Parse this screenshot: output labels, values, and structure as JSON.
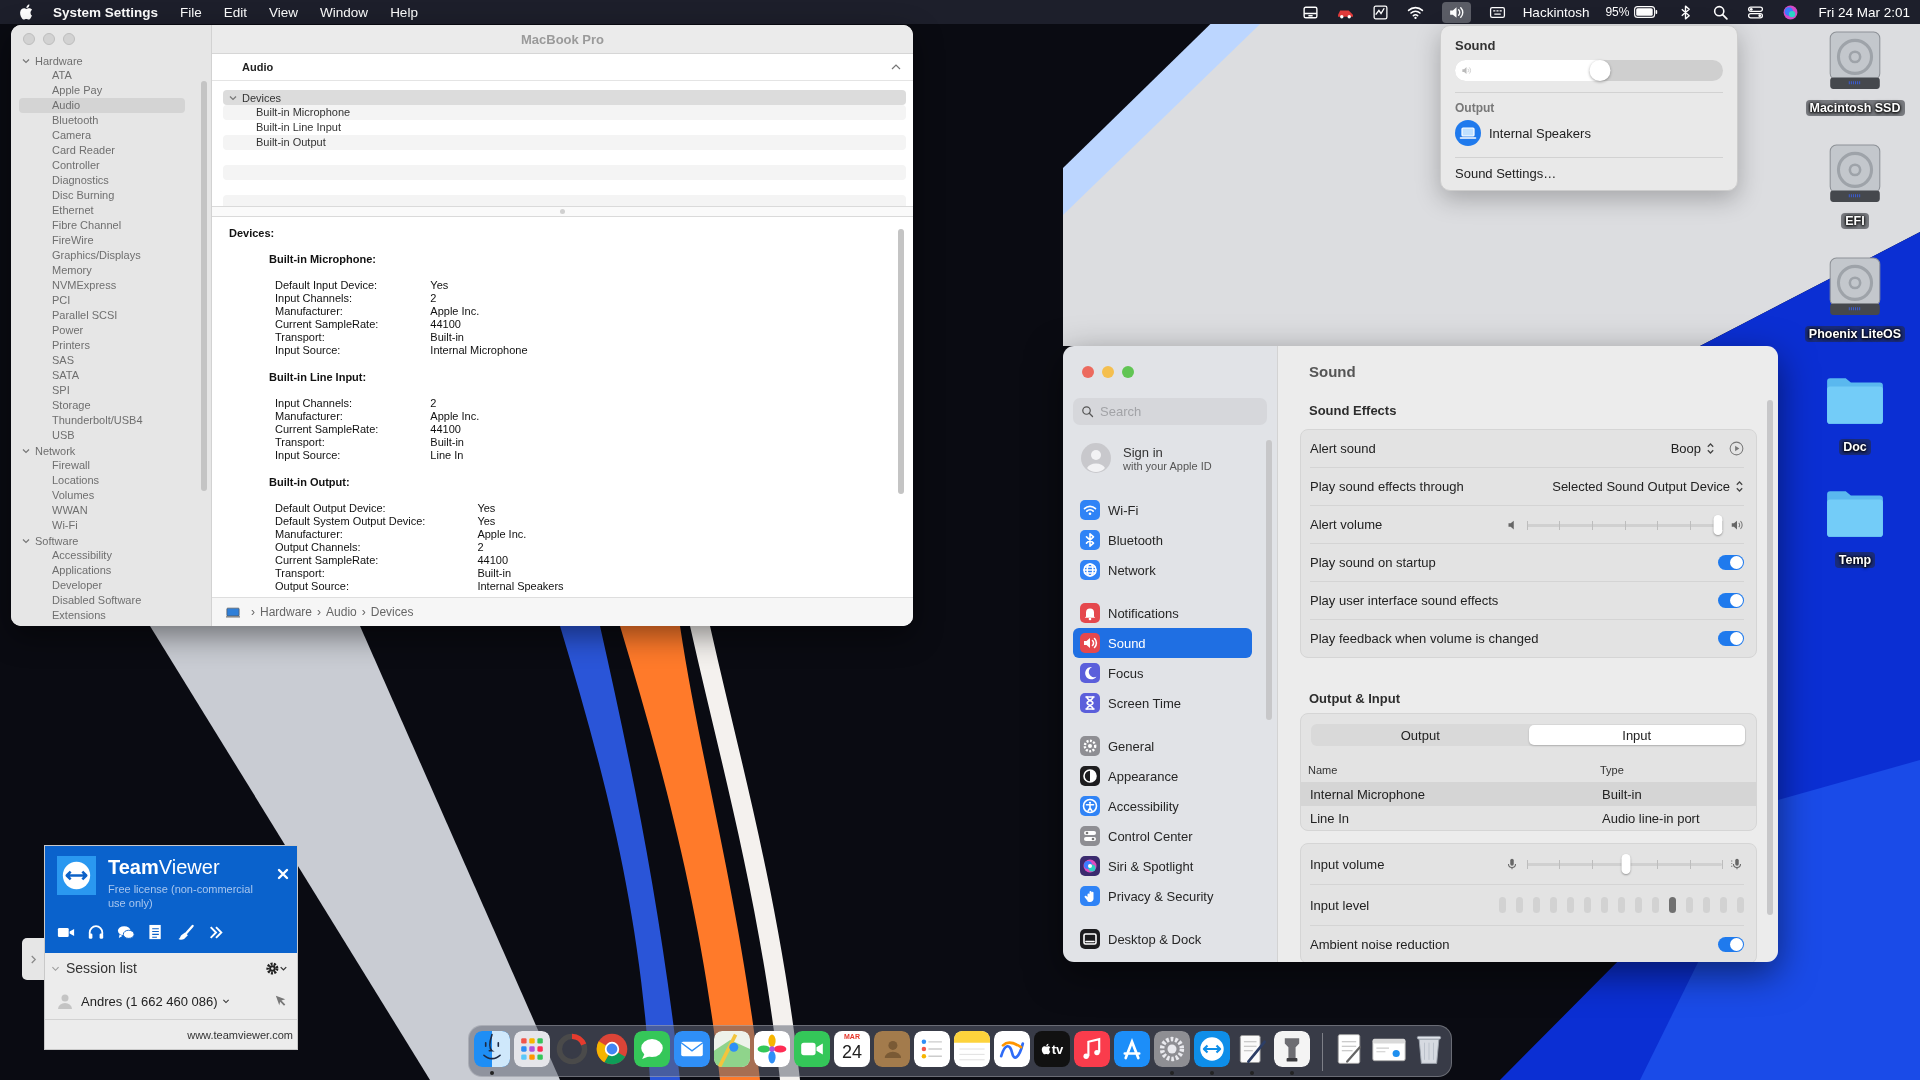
{
  "menu_bar": {
    "app_name": "System Settings",
    "menus": [
      "File",
      "Edit",
      "View",
      "Window",
      "Help"
    ],
    "host": "Hackintosh",
    "battery": "95%",
    "clock": "Fri 24 Mar 2:01"
  },
  "system_information": {
    "title": "MacBook Pro",
    "sidebar": [
      {
        "label": "Hardware",
        "expanded": true,
        "children": [
          {
            "label": "ATA",
            "selected": false
          },
          {
            "label": "Apple Pay",
            "selected": false
          },
          {
            "label": "Audio",
            "selected": true
          },
          {
            "label": "Bluetooth",
            "selected": false
          },
          {
            "label": "Camera",
            "selected": false
          },
          {
            "label": "Card Reader",
            "selected": false
          },
          {
            "label": "Controller",
            "selected": false
          },
          {
            "label": "Diagnostics",
            "selected": false
          },
          {
            "label": "Disc Burning",
            "selected": false
          },
          {
            "label": "Ethernet",
            "selected": false
          },
          {
            "label": "Fibre Channel",
            "selected": false
          },
          {
            "label": "FireWire",
            "selected": false
          },
          {
            "label": "Graphics/Displays",
            "selected": false
          },
          {
            "label": "Memory",
            "selected": false
          },
          {
            "label": "NVMExpress",
            "selected": false
          },
          {
            "label": "PCI",
            "selected": false
          },
          {
            "label": "Parallel SCSI",
            "selected": false
          },
          {
            "label": "Power",
            "selected": false
          },
          {
            "label": "Printers",
            "selected": false
          },
          {
            "label": "SAS",
            "selected": false
          },
          {
            "label": "SATA",
            "selected": false
          },
          {
            "label": "SPI",
            "selected": false
          },
          {
            "label": "Storage",
            "selected": false
          },
          {
            "label": "Thunderbolt/USB4",
            "selected": false
          },
          {
            "label": "USB",
            "selected": false
          }
        ]
      },
      {
        "label": "Network",
        "expanded": true,
        "children": [
          {
            "label": "Firewall",
            "selected": false
          },
          {
            "label": "Locations",
            "selected": false
          },
          {
            "label": "Volumes",
            "selected": false
          },
          {
            "label": "WWAN",
            "selected": false
          },
          {
            "label": "Wi-Fi",
            "selected": false
          }
        ]
      },
      {
        "label": "Software",
        "expanded": true,
        "children": [
          {
            "label": "Accessibility",
            "selected": false
          },
          {
            "label": "Applications",
            "selected": false
          },
          {
            "label": "Developer",
            "selected": false
          },
          {
            "label": "Disabled Software",
            "selected": false
          },
          {
            "label": "Extensions",
            "selected": false
          }
        ]
      }
    ],
    "pane_title": "Audio",
    "tree": {
      "label": "Devices",
      "expanded": true,
      "selected": true,
      "children": [
        {
          "label": "Built-in Microphone",
          "selected": false
        },
        {
          "label": "Built-in Line Input",
          "selected": false
        },
        {
          "label": "Built-in Output",
          "selected": false
        }
      ]
    },
    "details": {
      "heading": "Devices:",
      "groups": [
        {
          "title": "Built-in Microphone:",
          "rows": [
            {
              "label": "Default Input Device:",
              "value": "Yes"
            },
            {
              "label": "Input Channels:",
              "value": "2"
            },
            {
              "label": "Manufacturer:",
              "value": "Apple Inc."
            },
            {
              "label": "Current SampleRate:",
              "value": "44100"
            },
            {
              "label": "Transport:",
              "value": "Built-in"
            },
            {
              "label": "Input Source:",
              "value": "Internal Microphone"
            }
          ]
        },
        {
          "title": "Built-in Line Input:",
          "rows": [
            {
              "label": "Input Channels:",
              "value": "2"
            },
            {
              "label": "Manufacturer:",
              "value": "Apple Inc."
            },
            {
              "label": "Current SampleRate:",
              "value": "44100"
            },
            {
              "label": "Transport:",
              "value": "Built-in"
            },
            {
              "label": "Input Source:",
              "value": "Line In"
            }
          ]
        },
        {
          "title": "Built-in Output:",
          "rows": [
            {
              "label": "Default Output Device:",
              "value": "Yes"
            },
            {
              "label": "Default System Output Device:",
              "value": "Yes"
            },
            {
              "label": "Manufacturer:",
              "value": "Apple Inc."
            },
            {
              "label": "Output Channels:",
              "value": "2"
            },
            {
              "label": "Current SampleRate:",
              "value": "44100"
            },
            {
              "label": "Transport:",
              "value": "Built-in"
            },
            {
              "label": "Output Source:",
              "value": "Internal Speakers"
            }
          ]
        }
      ]
    },
    "path": [
      {
        "separator": "›",
        "label": "Hardware"
      },
      {
        "separator": "›",
        "label": "Audio"
      },
      {
        "separator": "›",
        "label": "Devices"
      }
    ]
  },
  "sound_popover": {
    "title": "Sound",
    "level": 0.54,
    "output_label": "Output",
    "device": "Internal Speakers",
    "settings": "Sound Settings…"
  },
  "desktop_icons": [
    {
      "label": "Macintosh SSD",
      "kind": "drive"
    },
    {
      "label": "EFI",
      "kind": "drive"
    },
    {
      "label": "Phoenix LiteOS",
      "kind": "drive"
    },
    {
      "label": "Doc",
      "kind": "folder"
    },
    {
      "label": "Temp",
      "kind": "folder"
    }
  ],
  "sound_settings": {
    "search": {
      "placeholder": "Search"
    },
    "account": {
      "title": "Sign in",
      "subtitle": "with your Apple ID"
    },
    "sidebar_groups": [
      {
        "items": [
          {
            "label": "Wi-Fi",
            "kind": "wifi",
            "color": "#2f83f6",
            "selected": false
          },
          {
            "label": "Bluetooth",
            "kind": "bluetooth",
            "color": "#2f83f6",
            "selected": false
          },
          {
            "label": "Network",
            "kind": "globe",
            "color": "#2f83f6",
            "selected": false
          }
        ]
      },
      {
        "items": [
          {
            "label": "Notifications",
            "kind": "bell",
            "color": "#e5484d",
            "selected": false
          },
          {
            "label": "Sound",
            "kind": "speaker",
            "color": "#e5484d",
            "selected": true
          },
          {
            "label": "Focus",
            "kind": "moon",
            "color": "#5b5fdb",
            "selected": false
          },
          {
            "label": "Screen Time",
            "kind": "hourglass",
            "color": "#5b5fdb",
            "selected": false
          }
        ]
      },
      {
        "items": [
          {
            "label": "General",
            "kind": "gear",
            "color": "#8e8e93",
            "selected": false
          },
          {
            "label": "Appearance",
            "kind": "half-circle",
            "color": "#1c1c1e",
            "selected": false
          },
          {
            "label": "Accessibility",
            "kind": "person",
            "color": "#2f83f6",
            "selected": false
          },
          {
            "label": "Control Center",
            "kind": "toggles",
            "color": "#8e8e93",
            "selected": false
          },
          {
            "label": "Siri & Spotlight",
            "kind": "orb",
            "color": "#3a2a6e",
            "selected": false
          },
          {
            "label": "Privacy & Security",
            "kind": "hand",
            "color": "#2f83f6",
            "selected": false
          }
        ]
      },
      {
        "items": [
          {
            "label": "Desktop & Dock",
            "kind": "dock",
            "color": "#1c1c1e",
            "selected": false
          }
        ]
      }
    ],
    "title": "Sound",
    "sound_effects": {
      "title": "Sound Effects",
      "rows": [
        {
          "kind": "popup",
          "label": "Alert sound",
          "value": "Boop",
          "play_button": true
        },
        {
          "kind": "popup",
          "label": "Play sound effects through",
          "value": "Selected Sound Output Device"
        },
        {
          "kind": "volume-slider",
          "label": "Alert volume",
          "level": 0.98
        },
        {
          "kind": "toggle",
          "label": "Play sound on startup",
          "on": true
        },
        {
          "kind": "toggle",
          "label": "Play user interface sound effects",
          "on": true
        },
        {
          "kind": "toggle",
          "label": "Play feedback when volume is changed",
          "on": true
        }
      ]
    },
    "output_input": {
      "title": "Output & Input",
      "segments": [
        {
          "label": "Output",
          "selected": false
        },
        {
          "label": "Input",
          "selected": true
        }
      ],
      "columns": [
        "Name",
        "Type"
      ],
      "devices": [
        {
          "name": "Internal Microphone",
          "type": "Built-in",
          "selected": true
        },
        {
          "name": "Line In",
          "type": "Audio line-in port",
          "selected": false
        }
      ],
      "rows": [
        {
          "kind": "mic-slider",
          "label": "Input volume",
          "level": 0.51
        },
        {
          "kind": "meter",
          "label": "Input level",
          "level": 0.72
        },
        {
          "kind": "toggle",
          "label": "Ambient noise reduction",
          "on": true
        }
      ]
    }
  },
  "teamviewer": {
    "title": "**Team**Viewer",
    "license": "Free license (non-commercial use only)",
    "session_list": "Session list",
    "session": "Andres (1 662 460 086)",
    "website": "www.teamviewer.com"
  },
  "dock": [
    {
      "kind": "smiling-face",
      "running": true
    },
    {
      "kind": "app-grid",
      "running": false
    },
    {
      "kind": "ring",
      "running": false
    },
    {
      "kind": "color-ball",
      "running": false
    },
    {
      "kind": "chat-bubble",
      "running": false
    },
    {
      "kind": "envelope",
      "running": false
    },
    {
      "kind": "map",
      "running": false
    },
    {
      "kind": "flower",
      "running": false
    },
    {
      "kind": "video-camera",
      "running": false
    },
    {
      "kind": "calendar",
      "month": "MAR",
      "day": "24",
      "running": false
    },
    {
      "kind": "contacts-book",
      "running": false
    },
    {
      "kind": "checklist",
      "running": false
    },
    {
      "kind": "notepad",
      "running": false
    },
    {
      "kind": "scribble",
      "running": false
    },
    {
      "kind": "tv",
      "label": "tv",
      "running": false
    },
    {
      "kind": "music-note",
      "running": false
    },
    {
      "kind": "a-shape",
      "running": false
    },
    {
      "kind": "gear",
      "running": true
    },
    {
      "kind": "arrows-circle",
      "running": true
    },
    {
      "kind": "pen-paper",
      "running": true
    },
    {
      "kind": "clamp",
      "running": true
    }
  ],
  "dock_extras": [
    {
      "kind": "document"
    },
    {
      "kind": "window-thumbnail"
    },
    {
      "kind": "trash"
    }
  ]
}
